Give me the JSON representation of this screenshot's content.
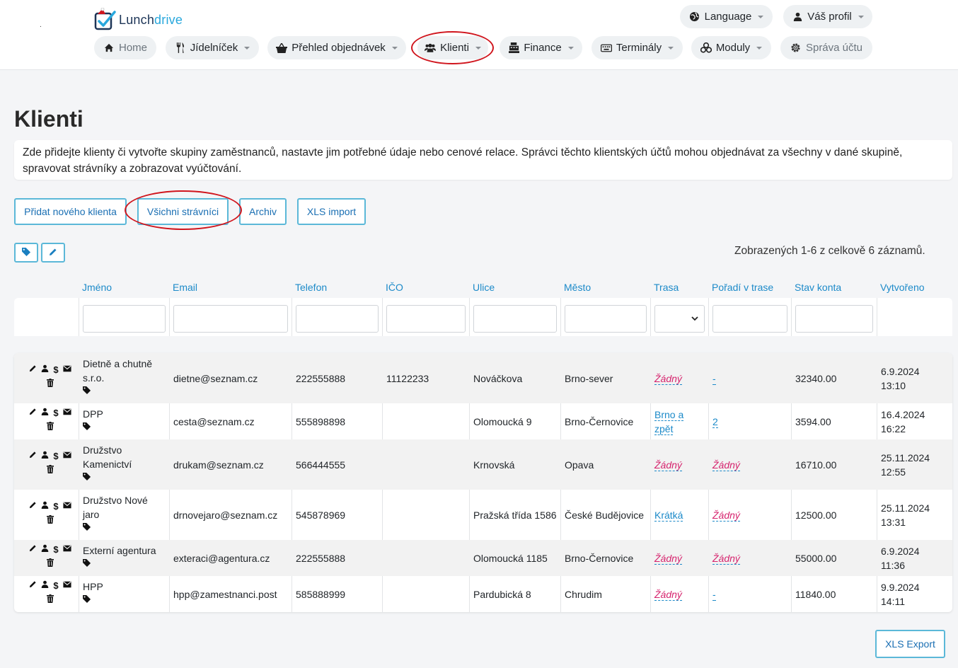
{
  "header": {
    "logo_icon": "lunchdrive-check-logo-icon",
    "logo_text_a": "Lunch",
    "logo_text_b": "drive",
    "dot": ".",
    "language": "Language",
    "profile": "Váš profil",
    "nav": [
      {
        "label": "Home",
        "icon": "home-icon"
      },
      {
        "label": "Jídelníček",
        "icon": "cutlery-icon"
      },
      {
        "label": "Přehled objednávek",
        "icon": "basket-icon"
      },
      {
        "label": "Klienti",
        "icon": "users-icon"
      },
      {
        "label": "Finance",
        "icon": "cash-register-icon"
      },
      {
        "label": "Terminály",
        "icon": "keyboard-icon"
      },
      {
        "label": "Moduly",
        "icon": "cubes-icon"
      },
      {
        "label": "Správa účtu",
        "icon": "gear-icon"
      }
    ]
  },
  "page": {
    "title": "Klienti",
    "intro": "Zde přidejte klienty či vytvořte skupiny zaměstnanců, nastavte jim potřebné údaje nebo cenové relace. Správci těchto klientských účtů mohou objednávat za všechny v dané skupině, spravovat strávníky a zobrazovat vyúčtování."
  },
  "buttons": {
    "add_client": "Přidat nového klienta",
    "all_diners": "Všichni strávníci",
    "archive": "Archiv",
    "xls_import": "XLS import",
    "xls_export": "XLS Export"
  },
  "table": {
    "count_text": "Zobrazených 1-6 z celkově 6 záznamů.",
    "columns": [
      "Jméno",
      "Email",
      "Telefon",
      "IČO",
      "Ulice",
      "Město",
      "Trasa",
      "Pořadí v trase",
      "Stav konta",
      "Vytvořeno"
    ],
    "rows": [
      {
        "name1": "Dietně a chutně",
        "name2": "s.r.o.",
        "email": "dietne@seznam.cz",
        "phone": "222555888",
        "ico": "11122233",
        "street": "Nováčkova",
        "city": "Brno-sever",
        "route1": "Žádný",
        "route2": "",
        "route_style": "pink",
        "order": "-",
        "order_style": "dash",
        "balance": "32340.00",
        "created1": "6.9.2024",
        "created2": "13:10"
      },
      {
        "name1": "DPP",
        "name2": "",
        "email": "cesta@seznam.cz",
        "phone": "555898898",
        "ico": "",
        "street": "Olomoucká 9",
        "city": "Brno-Černovice",
        "route1": "Brno a",
        "route2": "zpět",
        "route_style": "dash",
        "order": "2",
        "order_style": "dash",
        "balance": "3594.00",
        "created1": "16.4.2024",
        "created2": "16:22"
      },
      {
        "name1": "Družstvo",
        "name2": "Kamenictví",
        "email": "drukam@seznam.cz",
        "phone": "566444555",
        "ico": "",
        "street": "Krnovská",
        "city": "Opava",
        "route1": "Žádný",
        "route2": "",
        "route_style": "pink",
        "order": "Žádný",
        "order_style": "pink",
        "balance": "16710.00",
        "created1": "25.11.2024",
        "created2": "12:55"
      },
      {
        "name1": "Družstvo Nové",
        "name2": "jaro",
        "email": "drnovejaro@seznam.cz",
        "phone": "545878969",
        "ico": "",
        "street": "Pražská třída 1586",
        "city": "České Budějovice",
        "route1": "Krátká",
        "route2": "",
        "route_style": "dash",
        "order": "Žádný",
        "order_style": "pink",
        "balance": "12500.00",
        "created1": "25.11.2024",
        "created2": "13:31"
      },
      {
        "name1": "Externí agentura",
        "name2": "",
        "email": "exteraci@agentura.cz",
        "phone": "222555888",
        "ico": "",
        "street": "Olomoucká 1185",
        "city": "Brno-Černovice",
        "route1": "Žádný",
        "route2": "",
        "route_style": "pink",
        "order": "Žádný",
        "order_style": "pink",
        "balance": "55000.00",
        "created1": "6.9.2024",
        "created2": "11:36"
      },
      {
        "name1": "HPP",
        "name2": "",
        "email": "hpp@zamestnanci.post",
        "phone": "585888999",
        "ico": "",
        "street": "Pardubická 8",
        "city": "Chrudim",
        "route1": "Žádný",
        "route2": "",
        "route_style": "pink",
        "order": "-",
        "order_style": "dash",
        "balance": "11840.00",
        "created1": "9.9.2024",
        "created2": "14:11"
      }
    ]
  },
  "colors": {
    "accent": "#1c8ac9",
    "button_border": "#5bb8d8",
    "highlight_circle": "#d0151d",
    "pink_link": "#d6246e"
  }
}
